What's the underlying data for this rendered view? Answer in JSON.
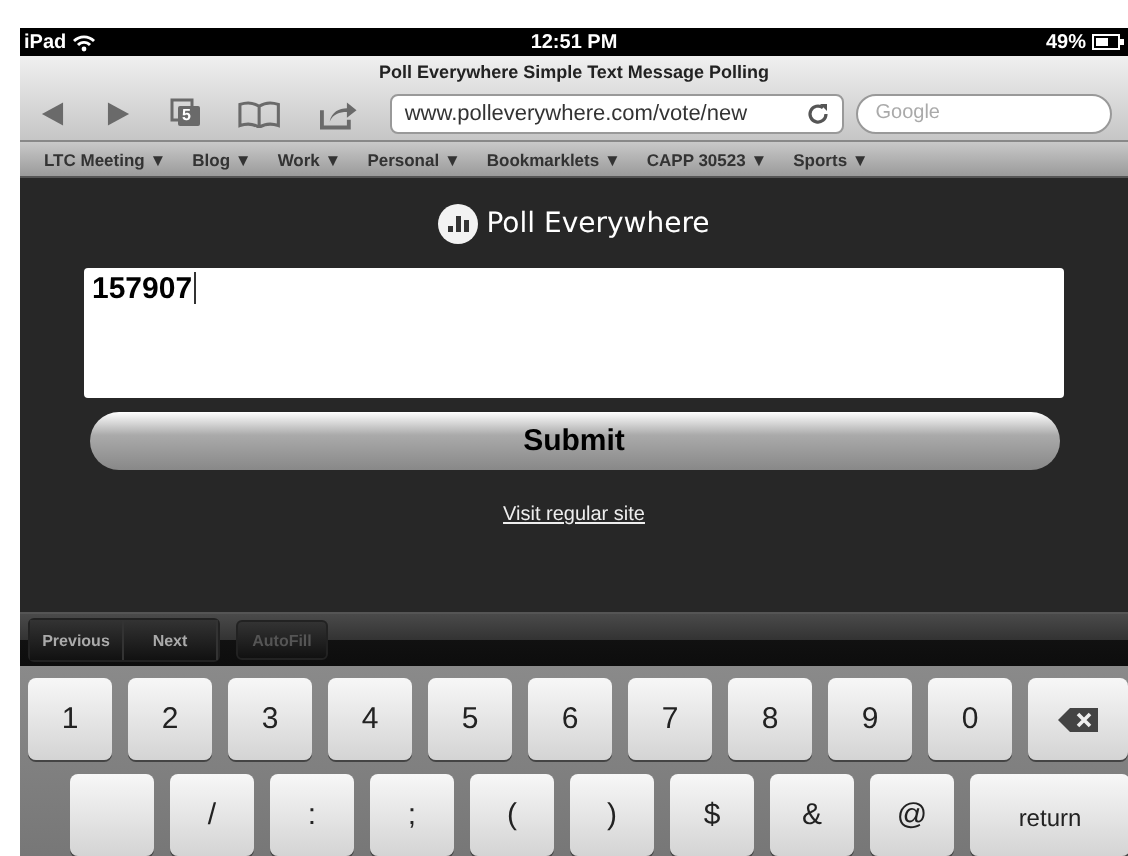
{
  "status_bar": {
    "device": "iPad",
    "time": "12:51 PM",
    "battery": "49%"
  },
  "browser": {
    "title": "Poll Everywhere Simple Text Message Polling",
    "url": "www.polleverywhere.com/vote/new",
    "search_placeholder": "Google",
    "tab_count": "5"
  },
  "bookmarks": [
    {
      "label": "LTC Meeting ▼"
    },
    {
      "label": "Blog ▼"
    },
    {
      "label": "Work ▼"
    },
    {
      "label": "Personal ▼"
    },
    {
      "label": "Bookmarklets ▼"
    },
    {
      "label": "CAPP 30523 ▼"
    },
    {
      "label": "Sports ▼"
    }
  ],
  "page": {
    "logo_text": "Poll Everywhere",
    "answer_value": "157907",
    "submit": "Submit",
    "link": "Visit regular site"
  },
  "form_assistant": [
    {
      "label": "Previous",
      "disabled": false
    },
    {
      "label": "Next",
      "disabled": false
    },
    {
      "label": "AutoFill",
      "disabled": true
    }
  ],
  "keyboard": [
    [
      {
        "kind": "char",
        "label": "1"
      },
      {
        "kind": "char",
        "label": "2"
      },
      {
        "kind": "char",
        "label": "3"
      },
      {
        "kind": "char",
        "label": "4"
      },
      {
        "kind": "char",
        "label": "5"
      },
      {
        "kind": "char",
        "label": "6"
      },
      {
        "kind": "char",
        "label": "7"
      },
      {
        "kind": "char",
        "label": "8"
      },
      {
        "kind": "char",
        "label": "9"
      },
      {
        "kind": "char",
        "label": "0"
      },
      {
        "kind": "delete"
      }
    ],
    [
      {
        "kind": "blank"
      },
      {
        "kind": "char",
        "label": "/"
      },
      {
        "kind": "char",
        "label": ":"
      },
      {
        "kind": "char",
        "label": ";"
      },
      {
        "kind": "char",
        "label": "("
      },
      {
        "kind": "char",
        "label": ")"
      },
      {
        "kind": "char",
        "label": "$"
      },
      {
        "kind": "char",
        "label": "&"
      },
      {
        "kind": "char",
        "label": "@"
      },
      {
        "kind": "return",
        "label": "return"
      }
    ]
  ]
}
